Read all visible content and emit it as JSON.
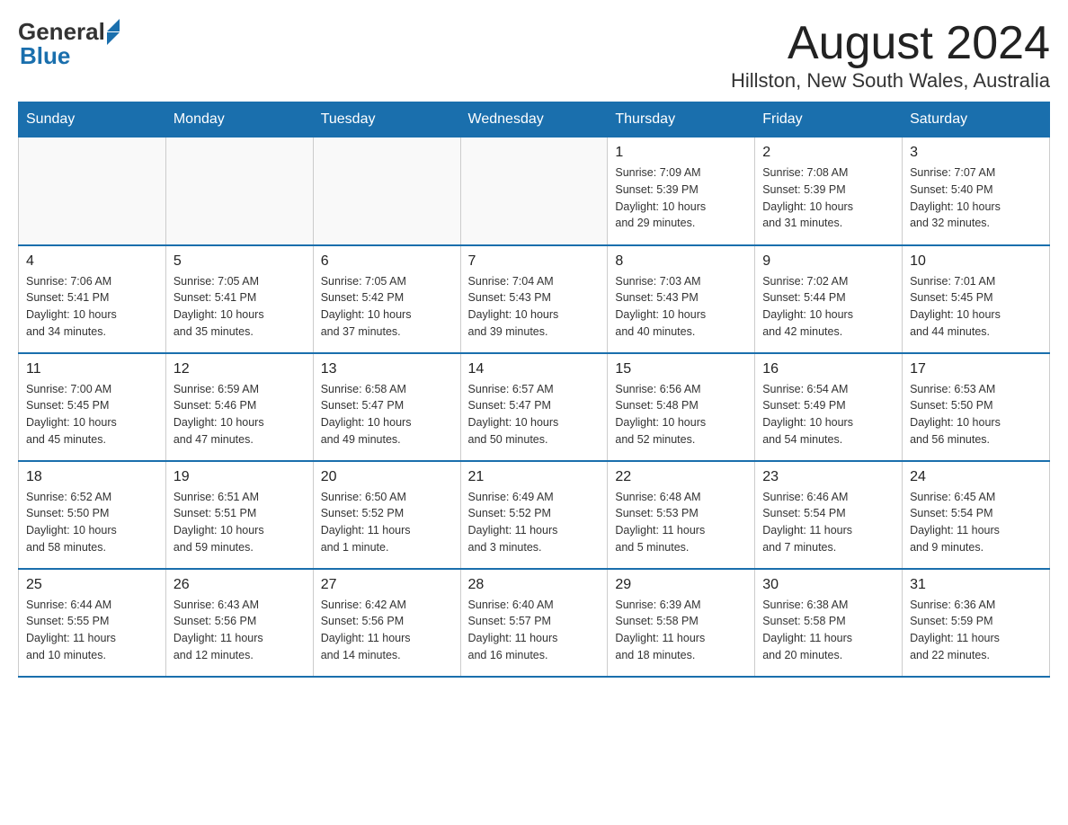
{
  "header": {
    "logo_general": "General",
    "logo_blue": "Blue",
    "month_title": "August 2024",
    "location": "Hillston, New South Wales, Australia"
  },
  "days_of_week": [
    "Sunday",
    "Monday",
    "Tuesday",
    "Wednesday",
    "Thursday",
    "Friday",
    "Saturday"
  ],
  "weeks": [
    [
      {
        "day": "",
        "info": ""
      },
      {
        "day": "",
        "info": ""
      },
      {
        "day": "",
        "info": ""
      },
      {
        "day": "",
        "info": ""
      },
      {
        "day": "1",
        "info": "Sunrise: 7:09 AM\nSunset: 5:39 PM\nDaylight: 10 hours\nand 29 minutes."
      },
      {
        "day": "2",
        "info": "Sunrise: 7:08 AM\nSunset: 5:39 PM\nDaylight: 10 hours\nand 31 minutes."
      },
      {
        "day": "3",
        "info": "Sunrise: 7:07 AM\nSunset: 5:40 PM\nDaylight: 10 hours\nand 32 minutes."
      }
    ],
    [
      {
        "day": "4",
        "info": "Sunrise: 7:06 AM\nSunset: 5:41 PM\nDaylight: 10 hours\nand 34 minutes."
      },
      {
        "day": "5",
        "info": "Sunrise: 7:05 AM\nSunset: 5:41 PM\nDaylight: 10 hours\nand 35 minutes."
      },
      {
        "day": "6",
        "info": "Sunrise: 7:05 AM\nSunset: 5:42 PM\nDaylight: 10 hours\nand 37 minutes."
      },
      {
        "day": "7",
        "info": "Sunrise: 7:04 AM\nSunset: 5:43 PM\nDaylight: 10 hours\nand 39 minutes."
      },
      {
        "day": "8",
        "info": "Sunrise: 7:03 AM\nSunset: 5:43 PM\nDaylight: 10 hours\nand 40 minutes."
      },
      {
        "day": "9",
        "info": "Sunrise: 7:02 AM\nSunset: 5:44 PM\nDaylight: 10 hours\nand 42 minutes."
      },
      {
        "day": "10",
        "info": "Sunrise: 7:01 AM\nSunset: 5:45 PM\nDaylight: 10 hours\nand 44 minutes."
      }
    ],
    [
      {
        "day": "11",
        "info": "Sunrise: 7:00 AM\nSunset: 5:45 PM\nDaylight: 10 hours\nand 45 minutes."
      },
      {
        "day": "12",
        "info": "Sunrise: 6:59 AM\nSunset: 5:46 PM\nDaylight: 10 hours\nand 47 minutes."
      },
      {
        "day": "13",
        "info": "Sunrise: 6:58 AM\nSunset: 5:47 PM\nDaylight: 10 hours\nand 49 minutes."
      },
      {
        "day": "14",
        "info": "Sunrise: 6:57 AM\nSunset: 5:47 PM\nDaylight: 10 hours\nand 50 minutes."
      },
      {
        "day": "15",
        "info": "Sunrise: 6:56 AM\nSunset: 5:48 PM\nDaylight: 10 hours\nand 52 minutes."
      },
      {
        "day": "16",
        "info": "Sunrise: 6:54 AM\nSunset: 5:49 PM\nDaylight: 10 hours\nand 54 minutes."
      },
      {
        "day": "17",
        "info": "Sunrise: 6:53 AM\nSunset: 5:50 PM\nDaylight: 10 hours\nand 56 minutes."
      }
    ],
    [
      {
        "day": "18",
        "info": "Sunrise: 6:52 AM\nSunset: 5:50 PM\nDaylight: 10 hours\nand 58 minutes."
      },
      {
        "day": "19",
        "info": "Sunrise: 6:51 AM\nSunset: 5:51 PM\nDaylight: 10 hours\nand 59 minutes."
      },
      {
        "day": "20",
        "info": "Sunrise: 6:50 AM\nSunset: 5:52 PM\nDaylight: 11 hours\nand 1 minute."
      },
      {
        "day": "21",
        "info": "Sunrise: 6:49 AM\nSunset: 5:52 PM\nDaylight: 11 hours\nand 3 minutes."
      },
      {
        "day": "22",
        "info": "Sunrise: 6:48 AM\nSunset: 5:53 PM\nDaylight: 11 hours\nand 5 minutes."
      },
      {
        "day": "23",
        "info": "Sunrise: 6:46 AM\nSunset: 5:54 PM\nDaylight: 11 hours\nand 7 minutes."
      },
      {
        "day": "24",
        "info": "Sunrise: 6:45 AM\nSunset: 5:54 PM\nDaylight: 11 hours\nand 9 minutes."
      }
    ],
    [
      {
        "day": "25",
        "info": "Sunrise: 6:44 AM\nSunset: 5:55 PM\nDaylight: 11 hours\nand 10 minutes."
      },
      {
        "day": "26",
        "info": "Sunrise: 6:43 AM\nSunset: 5:56 PM\nDaylight: 11 hours\nand 12 minutes."
      },
      {
        "day": "27",
        "info": "Sunrise: 6:42 AM\nSunset: 5:56 PM\nDaylight: 11 hours\nand 14 minutes."
      },
      {
        "day": "28",
        "info": "Sunrise: 6:40 AM\nSunset: 5:57 PM\nDaylight: 11 hours\nand 16 minutes."
      },
      {
        "day": "29",
        "info": "Sunrise: 6:39 AM\nSunset: 5:58 PM\nDaylight: 11 hours\nand 18 minutes."
      },
      {
        "day": "30",
        "info": "Sunrise: 6:38 AM\nSunset: 5:58 PM\nDaylight: 11 hours\nand 20 minutes."
      },
      {
        "day": "31",
        "info": "Sunrise: 6:36 AM\nSunset: 5:59 PM\nDaylight: 11 hours\nand 22 minutes."
      }
    ]
  ]
}
